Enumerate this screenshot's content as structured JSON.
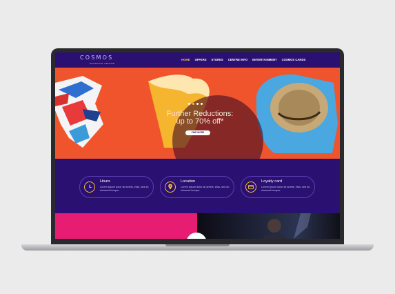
{
  "site": {
    "logo": "COSMOS",
    "logo_sub": "SHOPPING CENTRE"
  },
  "nav": {
    "items": [
      "HOME",
      "OFFERS",
      "STORES",
      "CENTRE INFO",
      "ENTERTAINMENT",
      "COSMOS CARDS"
    ],
    "active": "HOME"
  },
  "hero": {
    "title_line1": "Further Reductions:",
    "title_line2": "up to 70% off*",
    "button": "FIND MORE",
    "carousel": {
      "slides": 4,
      "active_index": 1
    }
  },
  "info": [
    {
      "title": "Hours",
      "text": "Lorem ipsum dolor sit amets, etas, sed do eiusmod tempor.",
      "icon": "clock-icon"
    },
    {
      "title": "Location",
      "text": "Lorem ipsum dolor sit amets, etas, sed do eiusmod tempor.",
      "icon": "location-pin-icon"
    },
    {
      "title": "Loyalty card",
      "text": "Lorem ipsum dolor sit amets, etas, sed do eiusmod tempor.",
      "icon": "card-icon"
    }
  ],
  "colors": {
    "brand_purple": "#2a1070",
    "accent_yellow": "#f7c13a",
    "hero_orange": "#f0542c",
    "pink": "#e71d74"
  }
}
